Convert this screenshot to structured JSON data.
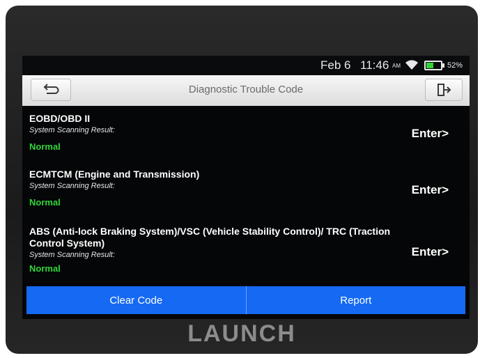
{
  "status_bar": {
    "date": "Feb 6",
    "time": "11:46",
    "ampm": "AM",
    "battery_percent": "52%",
    "battery_level": 0.52,
    "wifi_icon": "wifi-icon",
    "battery_icon": "battery-icon"
  },
  "header": {
    "title": "Diagnostic Trouble Code",
    "back_icon": "back-arrow-icon",
    "exit_icon": "exit-icon"
  },
  "systems": [
    {
      "name": "EOBD/OBD II",
      "scan_label": "System Scanning Result:",
      "status": "Normal",
      "enter_label": "Enter>"
    },
    {
      "name": "ECMTCM (Engine and Transmission)",
      "scan_label": "System Scanning Result:",
      "status": "Normal",
      "enter_label": "Enter>"
    },
    {
      "name": "ABS (Anti-lock Braking System)/VSC (Vehicle Stability Control)/ TRC (Traction Control System)",
      "scan_label": "System Scanning Result:",
      "status": "Normal",
      "enter_label": "Enter>"
    }
  ],
  "actions": {
    "clear_code": "Clear Code",
    "report": "Report"
  },
  "device": {
    "brand": "LAUNCH"
  },
  "colors": {
    "accent_blue": "#1569f2",
    "status_green": "#33d43b",
    "screen_bg": "#050607"
  }
}
